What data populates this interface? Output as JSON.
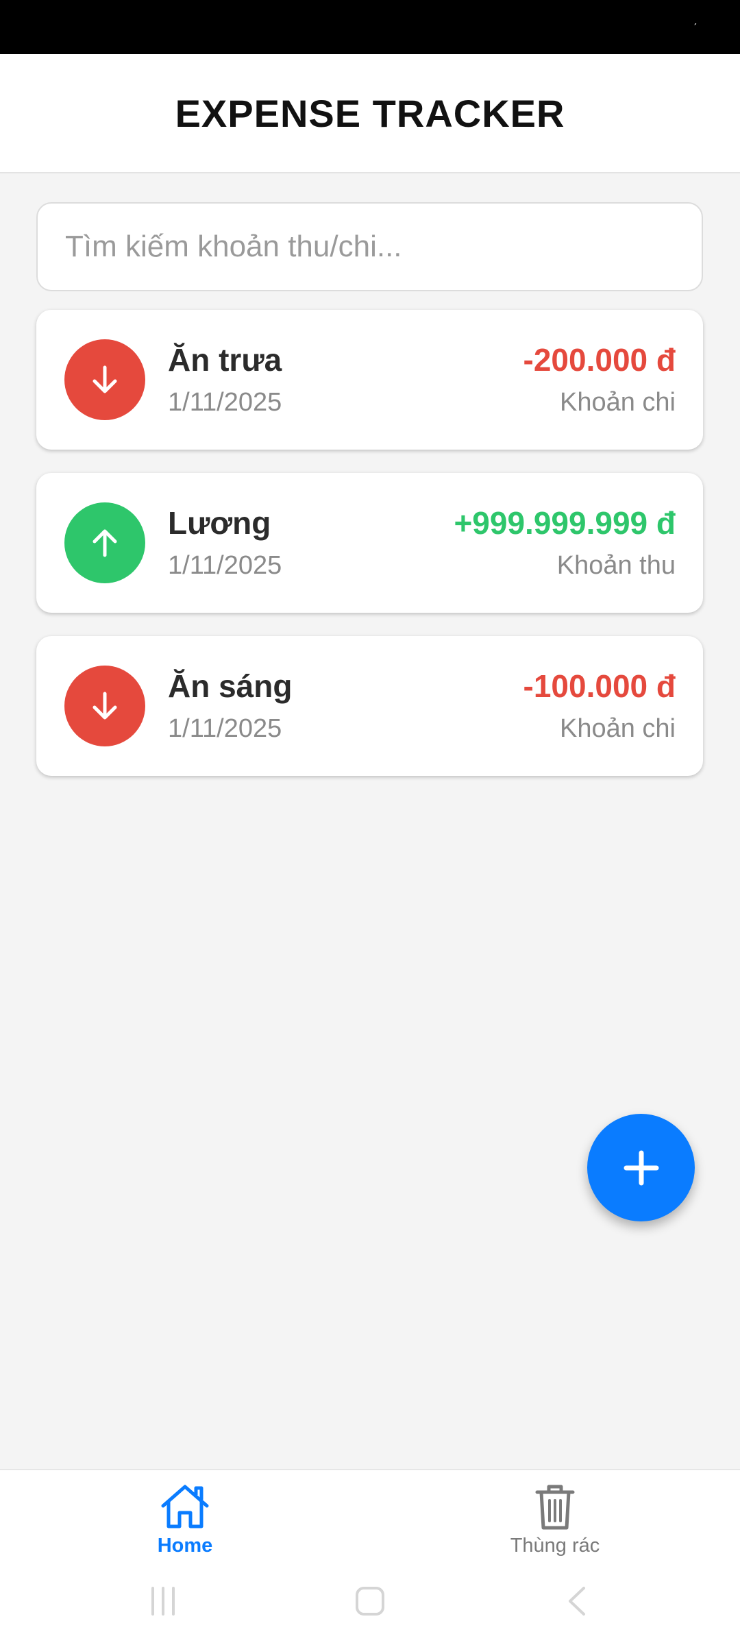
{
  "app": {
    "title": "EXPENSE TRACKER"
  },
  "search": {
    "placeholder": "Tìm kiếm khoản thu/chi..."
  },
  "transactions": [
    {
      "name": "Ăn trưa",
      "date": "1/11/2025",
      "amount": "-200.000 đ",
      "kind": "Khoản chi",
      "type": "expense",
      "icon": "arrow-down-icon",
      "color": "#e5493d"
    },
    {
      "name": "Lương",
      "date": "1/11/2025",
      "amount": "+999.999.999 đ",
      "kind": "Khoản thu",
      "type": "income",
      "icon": "arrow-up-icon",
      "color": "#2ec66b"
    },
    {
      "name": "Ăn sáng",
      "date": "1/11/2025",
      "amount": "-100.000 đ",
      "kind": "Khoản chi",
      "type": "expense",
      "icon": "arrow-down-icon",
      "color": "#e5493d"
    }
  ],
  "fab": {
    "icon": "plus-icon",
    "color": "#0a7cff"
  },
  "nav": {
    "home_label": "Home",
    "trash_label": "Thùng rác",
    "active": "home",
    "active_color": "#0a7cff",
    "inactive_color": "#7a7a7a"
  },
  "system_nav": {
    "icons": [
      "recent-apps-icon",
      "home-icon",
      "back-icon"
    ]
  }
}
